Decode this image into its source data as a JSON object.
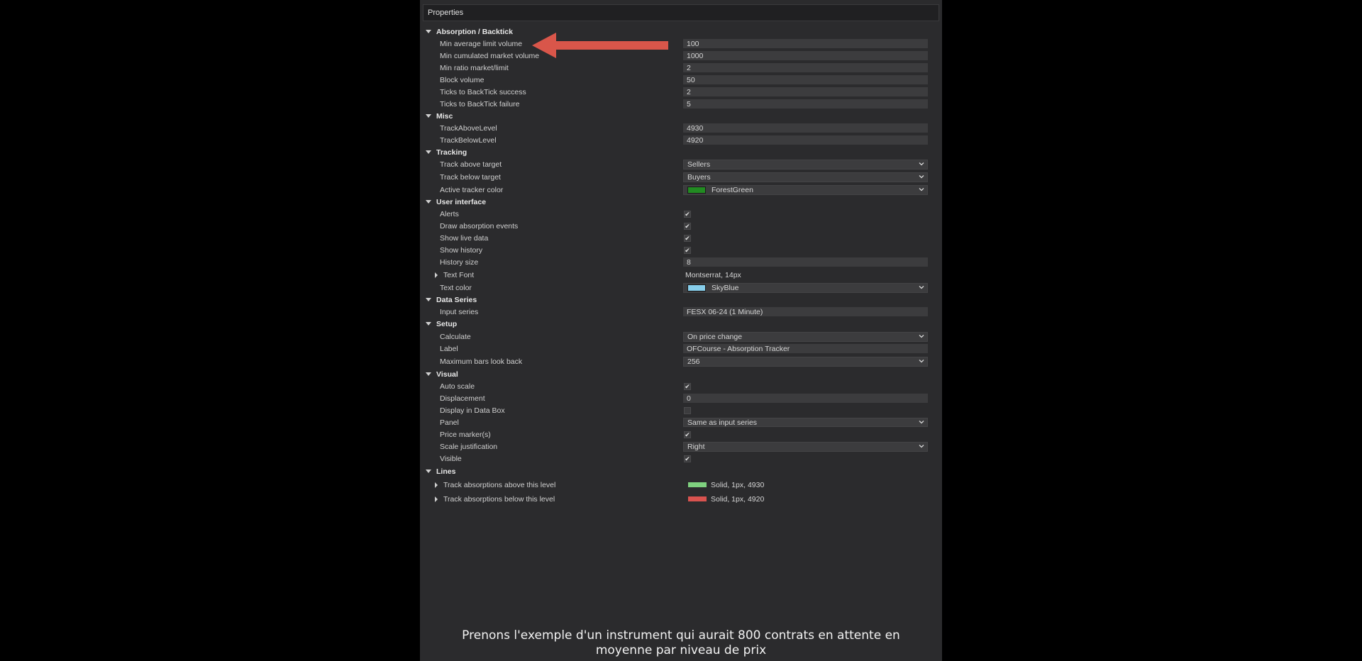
{
  "panel": {
    "title": "Properties"
  },
  "annotation": {
    "arrow_color": "#d9564a"
  },
  "caption": {
    "line1": "Prenons l'exemple d'un instrument qui aurait 800 contrats en attente en",
    "line2": "moyenne par niveau de prix"
  },
  "rows": [
    {
      "kind": "category",
      "label": "Absorption / Backtick"
    },
    {
      "kind": "text",
      "label": "Min average limit volume",
      "value": "100"
    },
    {
      "kind": "text",
      "label": "Min cumulated market volume",
      "value": "1000"
    },
    {
      "kind": "text",
      "label": "Min ratio market/limit",
      "value": "2"
    },
    {
      "kind": "text",
      "label": "Block volume",
      "value": "50"
    },
    {
      "kind": "text",
      "label": "Ticks to BackTick success",
      "value": "2"
    },
    {
      "kind": "text",
      "label": "Ticks to BackTick failure",
      "value": "5"
    },
    {
      "kind": "category",
      "label": "Misc"
    },
    {
      "kind": "text",
      "label": "TrackAboveLevel",
      "value": "4930"
    },
    {
      "kind": "text",
      "label": "TrackBelowLevel",
      "value": "4920"
    },
    {
      "kind": "category",
      "label": "Tracking"
    },
    {
      "kind": "combo",
      "label": "Track above target",
      "value": "Sellers"
    },
    {
      "kind": "combo",
      "label": "Track below target",
      "value": "Buyers"
    },
    {
      "kind": "color",
      "label": "Active tracker color",
      "value": "ForestGreen",
      "color": "#228b22"
    },
    {
      "kind": "category",
      "label": "User interface"
    },
    {
      "kind": "check",
      "label": "Alerts",
      "checked": true
    },
    {
      "kind": "check",
      "label": "Draw absorption events",
      "checked": true
    },
    {
      "kind": "check",
      "label": "Show live data",
      "checked": true
    },
    {
      "kind": "check",
      "label": "Show history",
      "checked": true
    },
    {
      "kind": "text",
      "label": "History size",
      "value": "8"
    },
    {
      "kind": "expand",
      "label": "Text Font",
      "value": "Montserrat, 14px"
    },
    {
      "kind": "color",
      "label": "Text color",
      "value": "SkyBlue",
      "color": "#87ceeb"
    },
    {
      "kind": "category",
      "label": "Data Series"
    },
    {
      "kind": "text",
      "label": "Input series",
      "value": "FESX 06-24 (1 Minute)"
    },
    {
      "kind": "category",
      "label": "Setup"
    },
    {
      "kind": "combo",
      "label": "Calculate",
      "value": "On price change"
    },
    {
      "kind": "text",
      "label": "Label",
      "value": "OFCourse - Absorption Tracker"
    },
    {
      "kind": "combo",
      "label": "Maximum bars look back",
      "value": "256"
    },
    {
      "kind": "category",
      "label": "Visual"
    },
    {
      "kind": "check",
      "label": "Auto scale",
      "checked": true
    },
    {
      "kind": "text",
      "label": "Displacement",
      "value": "0"
    },
    {
      "kind": "check",
      "label": "Display in Data Box",
      "checked": false
    },
    {
      "kind": "combo",
      "label": "Panel",
      "value": "Same as input series"
    },
    {
      "kind": "check",
      "label": "Price marker(s)",
      "checked": true
    },
    {
      "kind": "combo",
      "label": "Scale justification",
      "value": "Right"
    },
    {
      "kind": "check",
      "label": "Visible",
      "checked": true
    },
    {
      "kind": "category",
      "label": "Lines"
    },
    {
      "kind": "line",
      "label": "Track absorptions above this level",
      "value": "Solid, 1px, 4930",
      "color": "#7fd17f"
    },
    {
      "kind": "line",
      "label": "Track absorptions below this level",
      "value": "Solid, 1px, 4920",
      "color": "#d9534f"
    }
  ]
}
